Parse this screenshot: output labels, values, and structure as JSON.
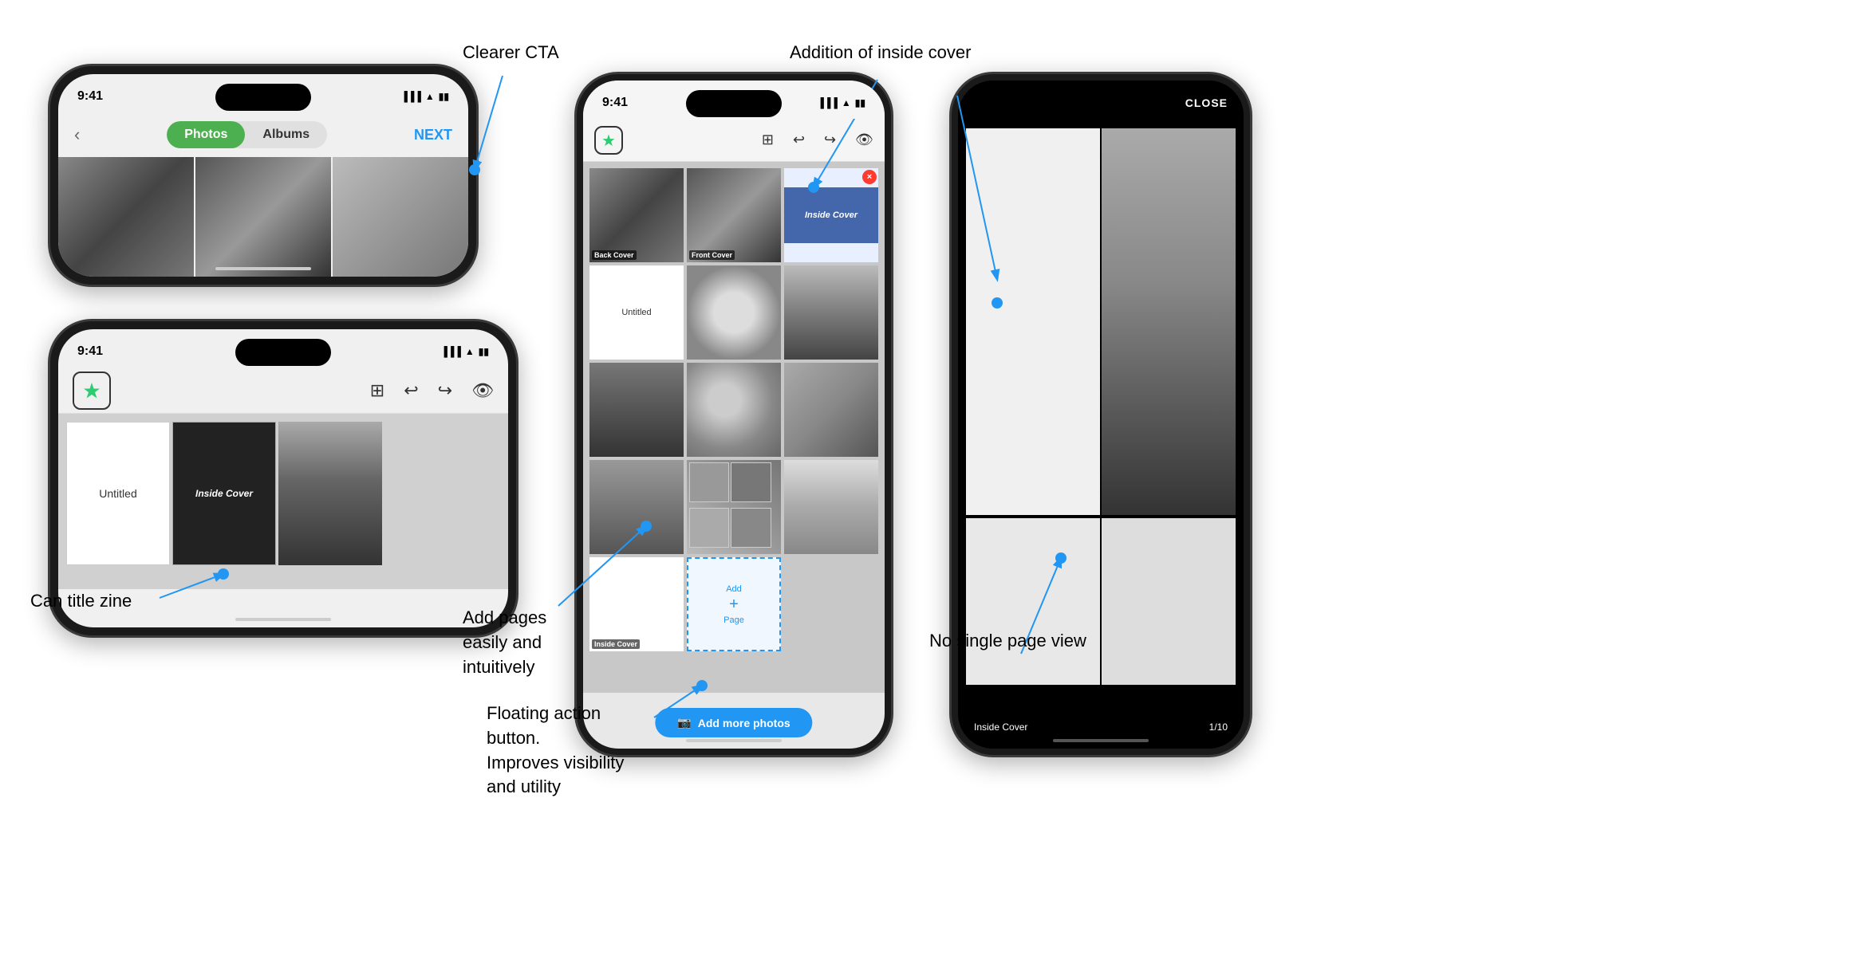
{
  "page": {
    "background": "#ffffff"
  },
  "annotations": {
    "clearer_cta": "Clearer CTA",
    "addition_inside_cover": "Addition of inside cover",
    "can_title_zine": "Can title zine",
    "add_pages": "Add pages easily and\nintuitively",
    "floating_action": "Floating action button.\nImproves visibility and utility",
    "no_single_page": "No single page view"
  },
  "phone1": {
    "time": "9:41",
    "tabs": {
      "photos": "Photos",
      "albums": "Albums"
    },
    "next_btn": "NEXT"
  },
  "phone2": {
    "time": "9:41",
    "toolbar_icons": [
      "⊞",
      "↩",
      "↪",
      "👁"
    ],
    "pages": {
      "untitled": "Untitled",
      "inside_cover": "Inside Cover"
    }
  },
  "phone3": {
    "time": "9:41",
    "toolbar_icons": [
      "⊞",
      "↩",
      "↪",
      "👁"
    ],
    "pages": [
      {
        "label": "Back Cover",
        "type": "photo"
      },
      {
        "label": "Front Cover",
        "type": "photo"
      },
      {
        "label": "",
        "title": "Untitled",
        "type": "title"
      },
      {
        "label": "Inside Cover",
        "type": "inside"
      },
      {
        "label": "",
        "type": "photo"
      },
      {
        "label": "",
        "type": "photo"
      },
      {
        "label": "",
        "type": "photo"
      },
      {
        "label": "",
        "type": "photo"
      },
      {
        "label": "",
        "type": "photo"
      },
      {
        "label": "",
        "type": "photo"
      },
      {
        "label": "",
        "type": "photo"
      },
      {
        "label": "",
        "type": "photo"
      },
      {
        "label": "Inside Cover",
        "type": "inside"
      },
      {
        "label": "",
        "type": "add"
      }
    ],
    "add_page": {
      "line1": "Add",
      "line2": "+",
      "line3": "Page"
    },
    "add_more": "Add more photos"
  },
  "phone4": {
    "close_label": "CLOSE",
    "inside_cover_label": "Inside Cover",
    "page_count": "1/10"
  }
}
